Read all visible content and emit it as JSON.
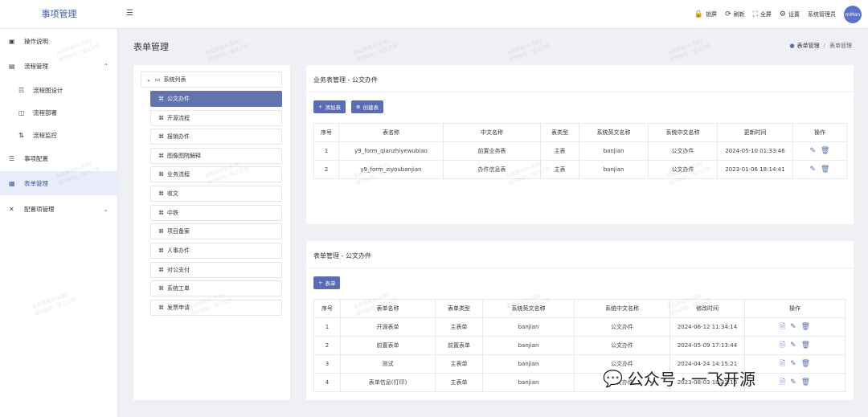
{
  "app": {
    "title": "事项管理"
  },
  "header": {
    "tools": [
      {
        "icon": "lock-icon",
        "glyph": "🔒",
        "label": "锁屏"
      },
      {
        "icon": "refresh-icon",
        "glyph": "⟳",
        "label": "刷新"
      },
      {
        "icon": "fullscreen-icon",
        "glyph": "⛶",
        "label": "全屏"
      },
      {
        "icon": "settings-icon",
        "glyph": "⚙",
        "label": "设置"
      }
    ],
    "user_name": "系统管理员",
    "avatar_text": "mMan"
  },
  "sidebar": {
    "items": [
      {
        "label": "操作说明",
        "icon": "book-icon"
      },
      {
        "label": "流程管理",
        "icon": "document-icon"
      },
      {
        "label": "流程图设计",
        "icon": "flow-design-icon"
      },
      {
        "label": "流程部署",
        "icon": "deploy-icon"
      },
      {
        "label": "流程监控",
        "icon": "monitor-icon"
      },
      {
        "label": "事项配置",
        "icon": "database-icon"
      },
      {
        "label": "表单管理",
        "icon": "table-icon"
      },
      {
        "label": "配置项管理",
        "icon": "tools-icon"
      }
    ]
  },
  "page": {
    "title": "表单管理"
  },
  "breadcrumb": {
    "items": [
      "表单管理",
      "表单管理"
    ]
  },
  "tree": {
    "root": "系统列表",
    "nodes": [
      "公文办件",
      "开源流程",
      "报销办件",
      "图像图院解释",
      "业务流程",
      "收文",
      "中铁",
      "项目备案",
      "人事办件",
      "对公支付",
      "系统工单",
      "发票申请"
    ]
  },
  "biz_table": {
    "title": "业务表管理 - 公文办件",
    "buttons": [
      "添加表",
      "创建表"
    ],
    "columns": [
      "序号",
      "表名称",
      "中文名称",
      "表类型",
      "系统英文名称",
      "系统中文名称",
      "更新时间",
      "操作"
    ],
    "rows": [
      [
        "1",
        "y9_form_qianzhiyewubiao",
        "前置业务表",
        "主表",
        "banjian",
        "公文办件",
        "2024-05-10 01:33:46"
      ],
      [
        "2",
        "y9_form_ziyoubanjian",
        "办件信息表",
        "主表",
        "banjian",
        "公文办件",
        "2023-01-06 18:14:41"
      ]
    ]
  },
  "form_table": {
    "title": "表单管理 - 公文办件",
    "buttons": [
      "表单"
    ],
    "columns": [
      "序号",
      "表单名称",
      "表单类型",
      "系统英文名称",
      "系统中文名称",
      "修改时间",
      "操作"
    ],
    "rows": [
      [
        "1",
        "开源表单",
        "主表单",
        "banjian",
        "公文办件",
        "2024-06-12 11:34:14"
      ],
      [
        "2",
        "前置表单",
        "前置表单",
        "banjian",
        "公文办件",
        "2024-05-09 17:13:44"
      ],
      [
        "3",
        "测试",
        "主表单",
        "banjian",
        "公文办件",
        "2024-04-24 14:15:21"
      ],
      [
        "4",
        "表单信息(打印)",
        "主表单",
        "banjian",
        "公文办件",
        "2023-08-03 10:32:16"
      ]
    ]
  },
  "watermark": {
    "line1": "系统管理员(系统)",
    "line2": "保守秘密，慎之又慎"
  },
  "overlay": {
    "brand": "公众号 · 一飞开源"
  }
}
